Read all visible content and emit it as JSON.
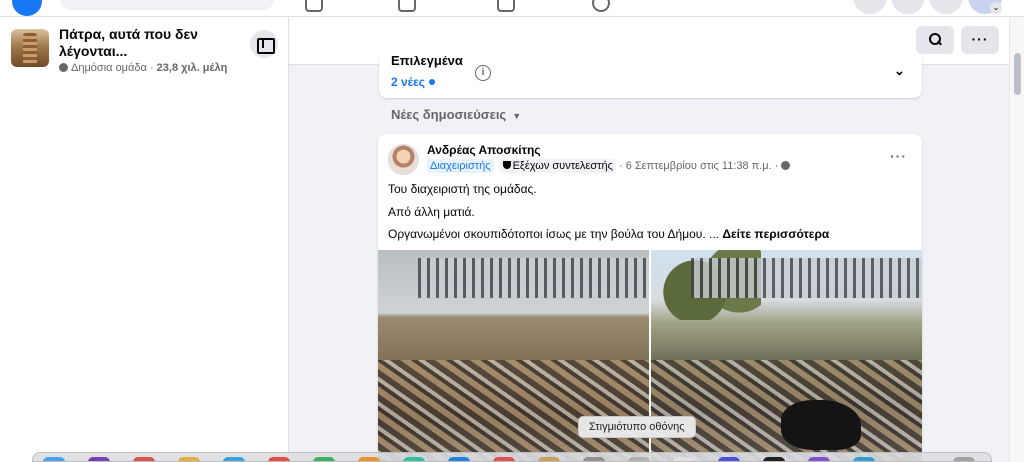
{
  "colors": {
    "brand_blue": "#1877f2",
    "secondary_text": "#65676b",
    "background": "#f0f2f5"
  },
  "topnav": {
    "logo_icon": "facebook-logo-icon",
    "nav_icons": [
      "home-icon",
      "video-icon",
      "groups-icon",
      "gaming-icon"
    ],
    "right_icons": [
      "menu-grid-icon",
      "messenger-icon",
      "notifications-icon"
    ]
  },
  "group": {
    "name": "Πάτρα, αυτά που δεν λέγονται...",
    "privacy": "Δημόσια ομάδα",
    "separator": "·",
    "members": "23,8 χιλ. μέλη"
  },
  "featured": {
    "title": "Επιλεγμένα",
    "new_count": "2 νέες",
    "info_symbol": "i",
    "chevron_symbol": "⌄"
  },
  "sort": {
    "label": "Νέες δημοσιεύσεις",
    "caret": "▼"
  },
  "post": {
    "author": "Ανδρέας Αποσκίτης",
    "badge_admin": "Διαχειριστής",
    "badge_contributor": "Εξέχων συντελεστής",
    "date": "· 6 Σεπτεμβρίου στις 11:38 π.μ. ·",
    "more": "···",
    "lines": [
      "Του διαχειριστή της ομάδας.",
      "Από άλλη ματιά.",
      "Οργανωμένοι σκουπιδότοποι ίσως με την βούλα του Δήμου. ..."
    ],
    "see_more": "Δείτε περισσότερα"
  },
  "header_buttons": {
    "more": "···"
  },
  "tooltip": "Στιγμιότυπο οθόνης"
}
